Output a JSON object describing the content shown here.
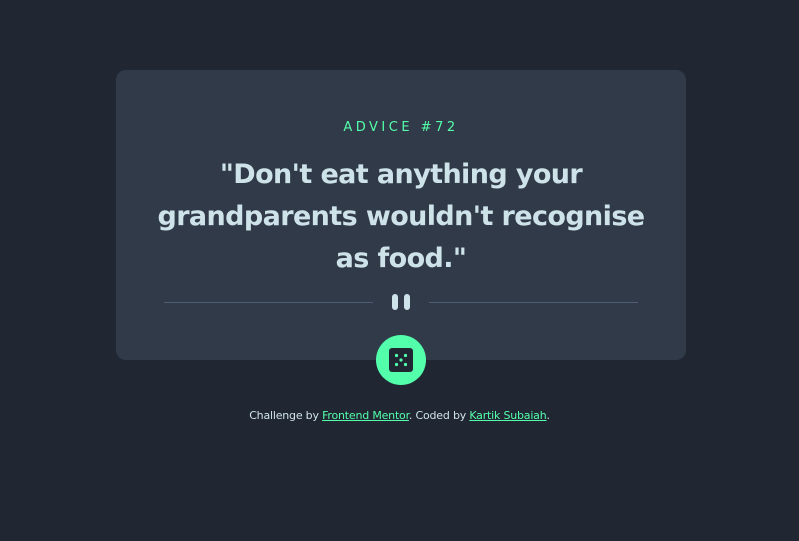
{
  "advice": {
    "title": "ADVICE #72",
    "quote": "\"Don't eat anything your grandparents wouldn't recognise as food.\""
  },
  "icons": {
    "divider": "pause-icon",
    "button": "dice-icon"
  },
  "footer": {
    "prefix": "Challenge by ",
    "link1": "Frontend Mentor",
    "middle": ". Coded by ",
    "link2": "Kartik Subaiah",
    "suffix": "."
  },
  "colors": {
    "background": "#202733",
    "card": "#313a48",
    "accent": "#53ffaa",
    "text": "#cee3e9",
    "divider": "#4f5d74"
  }
}
